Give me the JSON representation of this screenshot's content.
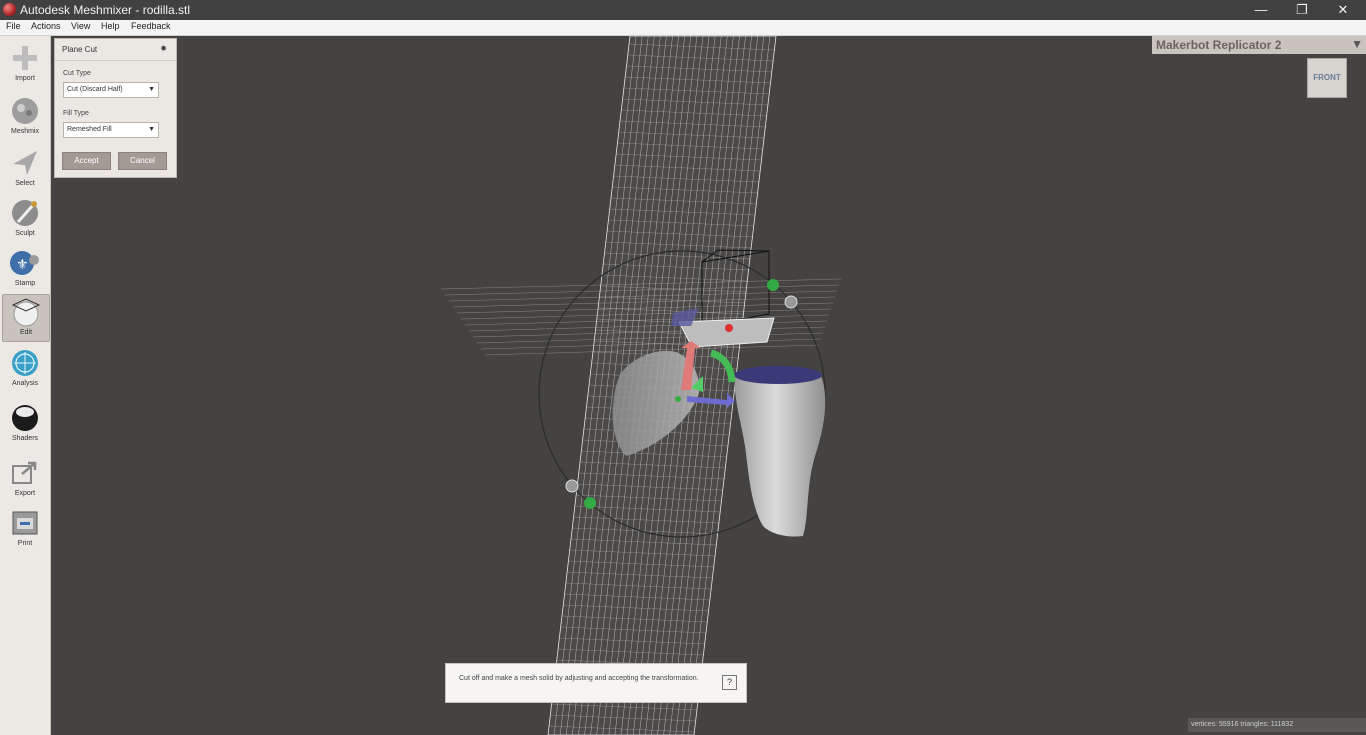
{
  "titlebar": {
    "title": "Autodesk Meshmixer - rodilla.stl",
    "minimize": "—",
    "restore": "❐",
    "close": "✕"
  },
  "menu": [
    "File",
    "Actions",
    "View",
    "Help",
    "Feedback"
  ],
  "tools": [
    {
      "label": "Import",
      "icon": "import-icon"
    },
    {
      "label": "Meshmix",
      "icon": "meshmix-icon"
    },
    {
      "label": "Select",
      "icon": "select-icon"
    },
    {
      "label": "Sculpt",
      "icon": "sculpt-icon"
    },
    {
      "label": "Stamp",
      "icon": "stamp-icon"
    },
    {
      "label": "Edit",
      "icon": "edit-icon",
      "active": true
    },
    {
      "label": "Analysis",
      "icon": "analysis-icon"
    },
    {
      "label": "Shaders",
      "icon": "shaders-icon"
    },
    {
      "label": "Export",
      "icon": "export-icon"
    },
    {
      "label": "Print",
      "icon": "print-icon"
    }
  ],
  "panel": {
    "title": "Plane Cut",
    "cut_type_label": "Cut Type",
    "cut_type_value": "Cut (Discard Half)",
    "fill_type_label": "Fill Type",
    "fill_type_value": "Remeshed Fill",
    "accept": "Accept",
    "cancel": "Cancel"
  },
  "printer": {
    "name": "Makerbot Replicator 2"
  },
  "navcube": {
    "face": "FRONT"
  },
  "tooltip": {
    "text": "Cut off and make a mesh solid by adjusting and accepting the transformation.",
    "help": "?"
  },
  "status": {
    "stats": "vertices: 55916 triangles: 111832"
  }
}
